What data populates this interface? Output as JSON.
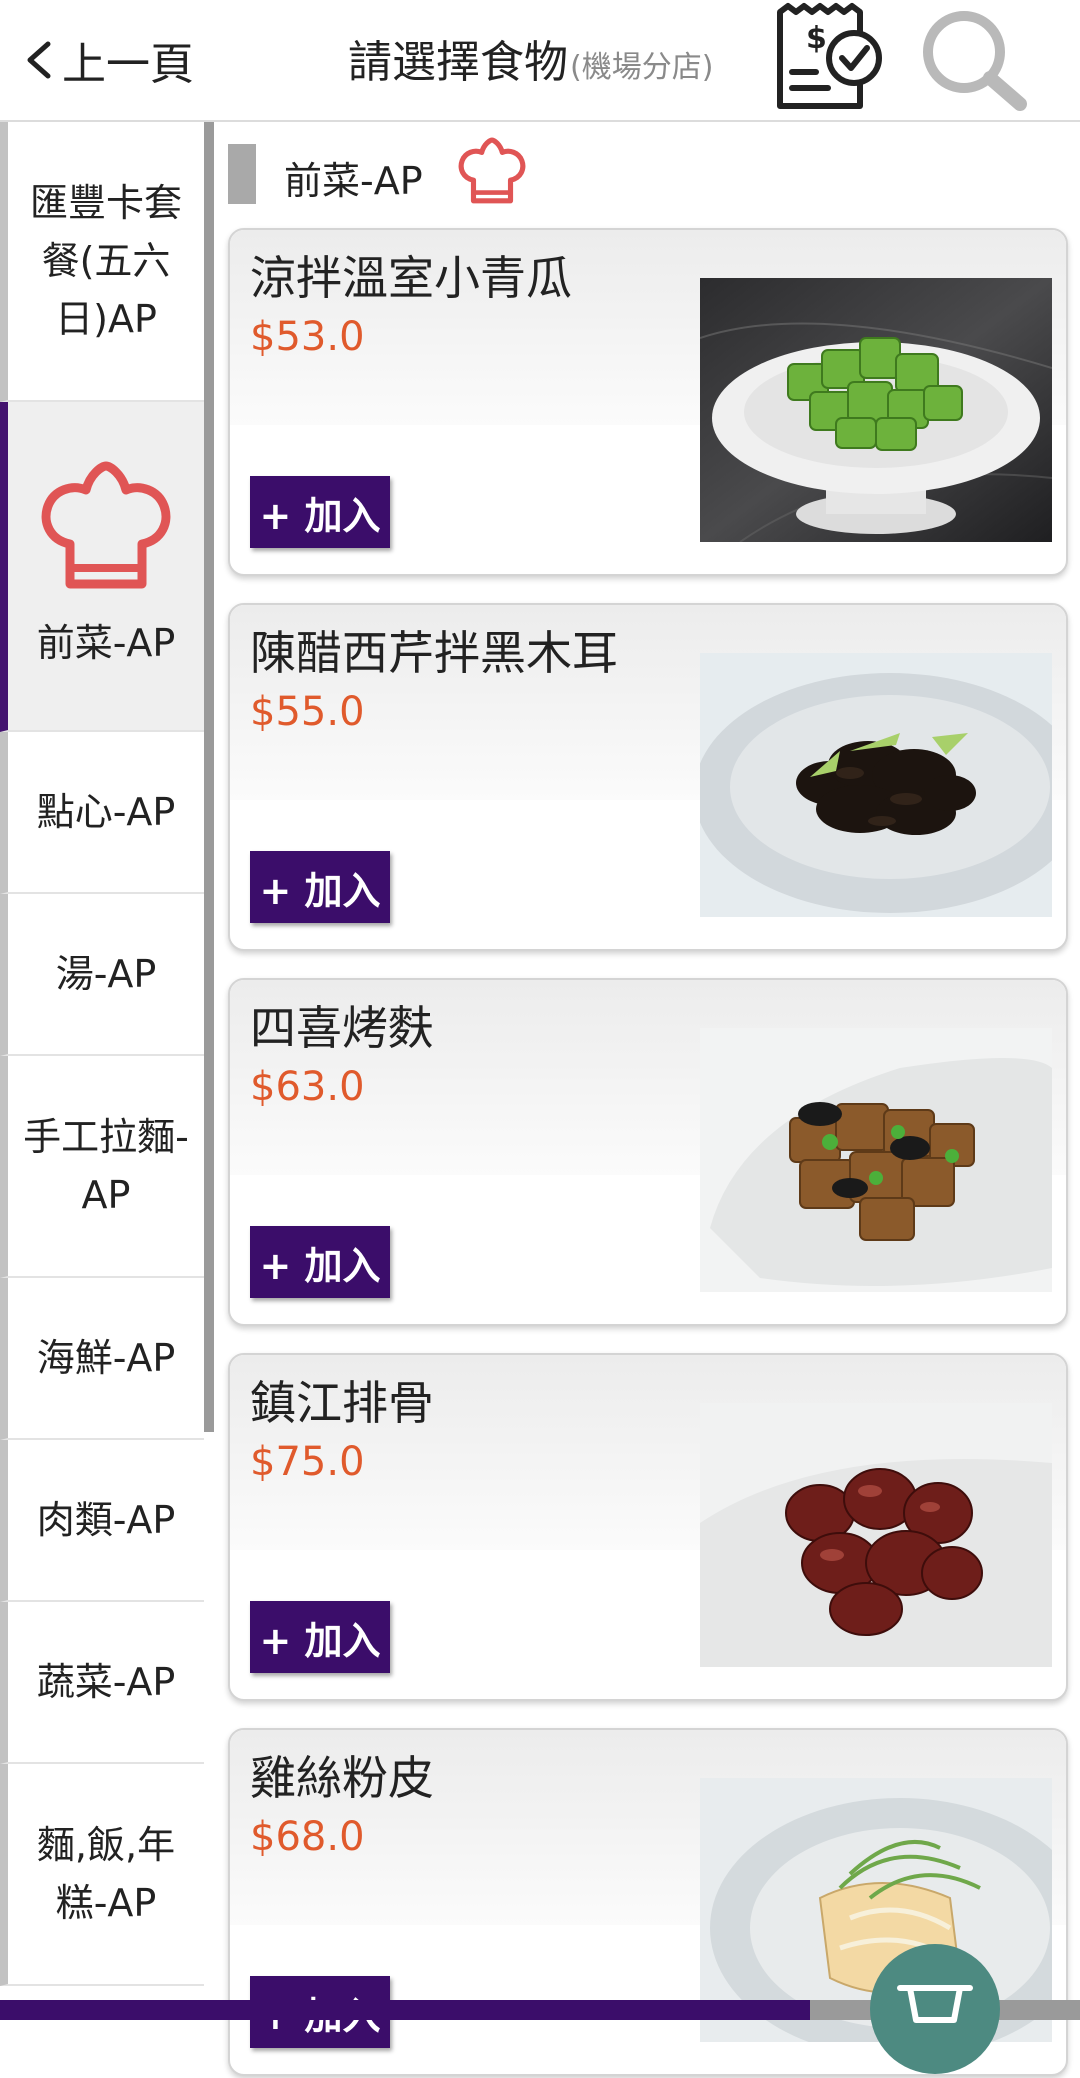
{
  "header": {
    "back_label": "上一頁",
    "title": "請選擇食物",
    "branch": "(機場分店)"
  },
  "sidebar": {
    "items": [
      {
        "label": "匯豐卡套餐(五六日)AP"
      },
      {
        "label": "前菜-AP",
        "active": true,
        "icon": "chef-hat-icon"
      },
      {
        "label": "點心-AP"
      },
      {
        "label": "湯-AP"
      },
      {
        "label": "手工拉麵-AP"
      },
      {
        "label": "海鮮-AP"
      },
      {
        "label": "肉類-AP"
      },
      {
        "label": "蔬菜-AP"
      },
      {
        "label": "麵,飯,年糕-AP"
      }
    ]
  },
  "category": {
    "title": "前菜-AP",
    "icon": "chef-hat-icon"
  },
  "items": [
    {
      "name": "涼拌溫室小青瓜",
      "price": "$53.0",
      "add_label": "+ 加入"
    },
    {
      "name": "陳醋西芹拌黑木耳",
      "price": "$55.0",
      "add_label": "+ 加入"
    },
    {
      "name": "四喜烤麩",
      "price": "$63.0",
      "add_label": "+ 加入"
    },
    {
      "name": "鎮江排骨",
      "price": "$75.0",
      "add_label": "+ 加入"
    },
    {
      "name": "雞絲粉皮",
      "price": "$68.0",
      "add_label": "+ 加入"
    }
  ],
  "colors": {
    "accent": "#3b0d6a",
    "price": "#e05a2c",
    "hat": "#e05555",
    "cart": "#4d8a81"
  }
}
